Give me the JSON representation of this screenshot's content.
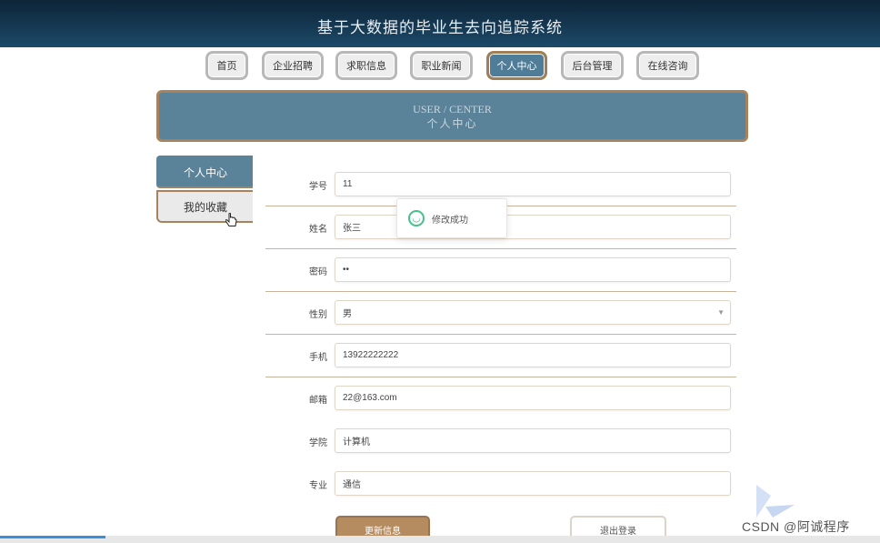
{
  "header": {
    "title": "基于大数据的毕业生去向追踪系统"
  },
  "nav": {
    "items": [
      {
        "label": "首页",
        "active": false
      },
      {
        "label": "企业招聘",
        "active": false
      },
      {
        "label": "求职信息",
        "active": false
      },
      {
        "label": "职业新闻",
        "active": false
      },
      {
        "label": "个人中心",
        "active": true
      },
      {
        "label": "后台管理",
        "active": false
      },
      {
        "label": "在线咨询",
        "active": false
      }
    ]
  },
  "banner": {
    "en": "USER / CENTER",
    "cn": "个人中心"
  },
  "sidebar": {
    "items": [
      {
        "label": "个人中心",
        "active": true
      },
      {
        "label": "我的收藏",
        "active": false
      }
    ]
  },
  "form": {
    "fields": [
      {
        "label": "学号",
        "value": "11"
      },
      {
        "label": "姓名",
        "value": "张三"
      },
      {
        "label": "密码",
        "value": "••"
      },
      {
        "label": "性别",
        "value": "男"
      },
      {
        "label": "手机",
        "value": "13922222222"
      },
      {
        "label": "邮箱",
        "value": "22@163.com"
      },
      {
        "label": "学院",
        "value": "计算机"
      },
      {
        "label": "专业",
        "value": "通信"
      }
    ],
    "save_label": "更新信息",
    "logout_label": "退出登录"
  },
  "toast": {
    "message": "修改成功"
  },
  "watermark": {
    "text": "CSDN @阿诚程序"
  },
  "colors": {
    "header": "#1c4a68",
    "accent": "#5a8299",
    "brown": "#a8825a",
    "success": "#45c18a"
  }
}
